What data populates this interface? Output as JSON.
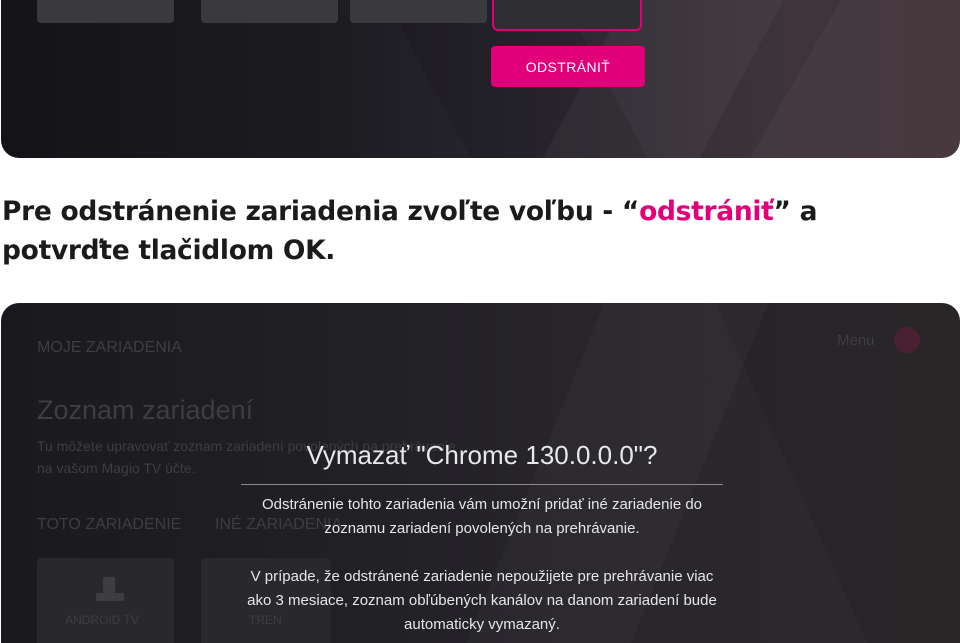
{
  "top": {
    "remove_button": "ODSTRÁNIŤ"
  },
  "instruction": {
    "before": "Pre odstránenie zariadenia zvoľte voľbu - “",
    "highlight": "odstrániť",
    "after": "” a potvrďte tlačidlom OK."
  },
  "background_screen": {
    "section_title": "MOJE ZARIADENIA",
    "menu_label": "Menu",
    "heading": "Zoznam zariadení",
    "description": "Tu môžete upravovať zoznam zariadení povolených na prehrávanie na vašom Magio TV účte.",
    "tab_this_device": "TOTO ZARIADENIE",
    "tab_other_devices": "INÉ ZARIADENIA",
    "card1_label": "ANDROID TV",
    "card2_label": "TREN"
  },
  "dialog": {
    "title": "Vymazať \"Chrome 130.0.0.0\"?",
    "paragraph1": "Odstránenie tohto zariadenia vám umožní pridať iné zariadenie do zoznamu zariadení povolených na prehrávanie.",
    "paragraph2": "V prípade, že odstránené zariadenie nepoužijete pre prehrávanie viac ako 3 mesiace, zoznam obľúbených kanálov na danom zariadení bude automaticky vymazaný."
  },
  "colors": {
    "accent": "#e2007a",
    "panel": "#1d1c21"
  }
}
